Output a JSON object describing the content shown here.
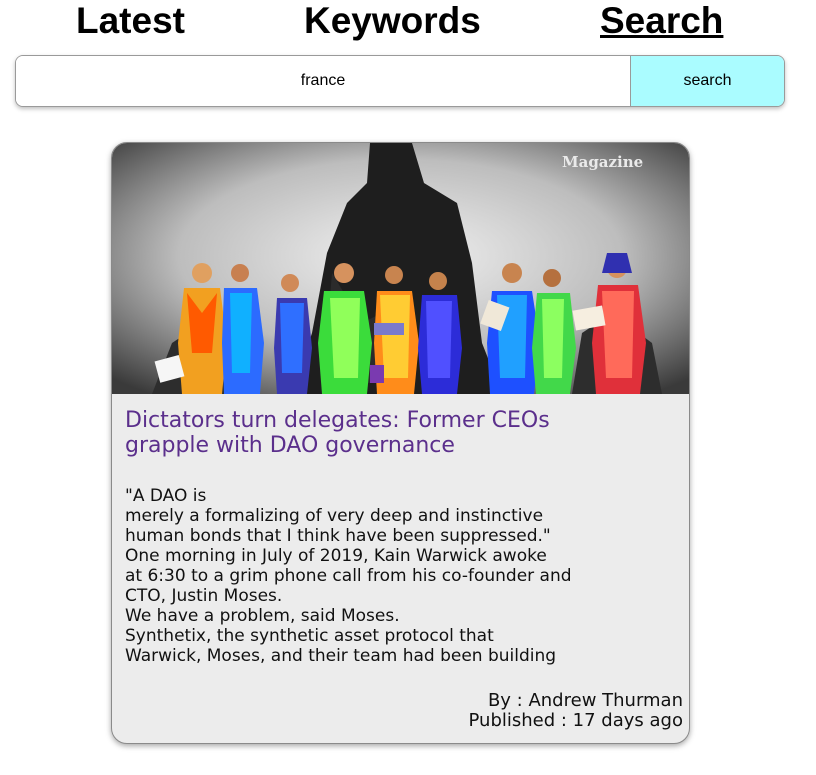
{
  "nav": {
    "latest": "Latest",
    "keywords": "Keywords",
    "search": "Search"
  },
  "search": {
    "value": "france",
    "button_label": "search"
  },
  "article": {
    "image_alt": "Magazine",
    "title_line1": "Dictators turn delegates: Former CEOs",
    "title_line2": "grapple with DAO governance",
    "excerpt_lines": [
      "\"A DAO is",
      "merely a formalizing of very deep and instinctive",
      "human bonds that I think have been suppressed.\"",
      "One morning in July of 2019, Kain Warwick awoke",
      "at 6:30 to a grim phone call from his co-founder and",
      "CTO, Justin Moses.",
      "We have a problem, said Moses.",
      "Synthetix, the synthetic asset protocol that",
      "Warwick, Moses, and their team had been building"
    ],
    "author": "By : Andrew Thurman",
    "published": "Published : 17 days ago"
  },
  "colors": {
    "search_button_bg": "#aafcff",
    "title_color": "#5b2f8c",
    "card_bg": "#ececec"
  }
}
